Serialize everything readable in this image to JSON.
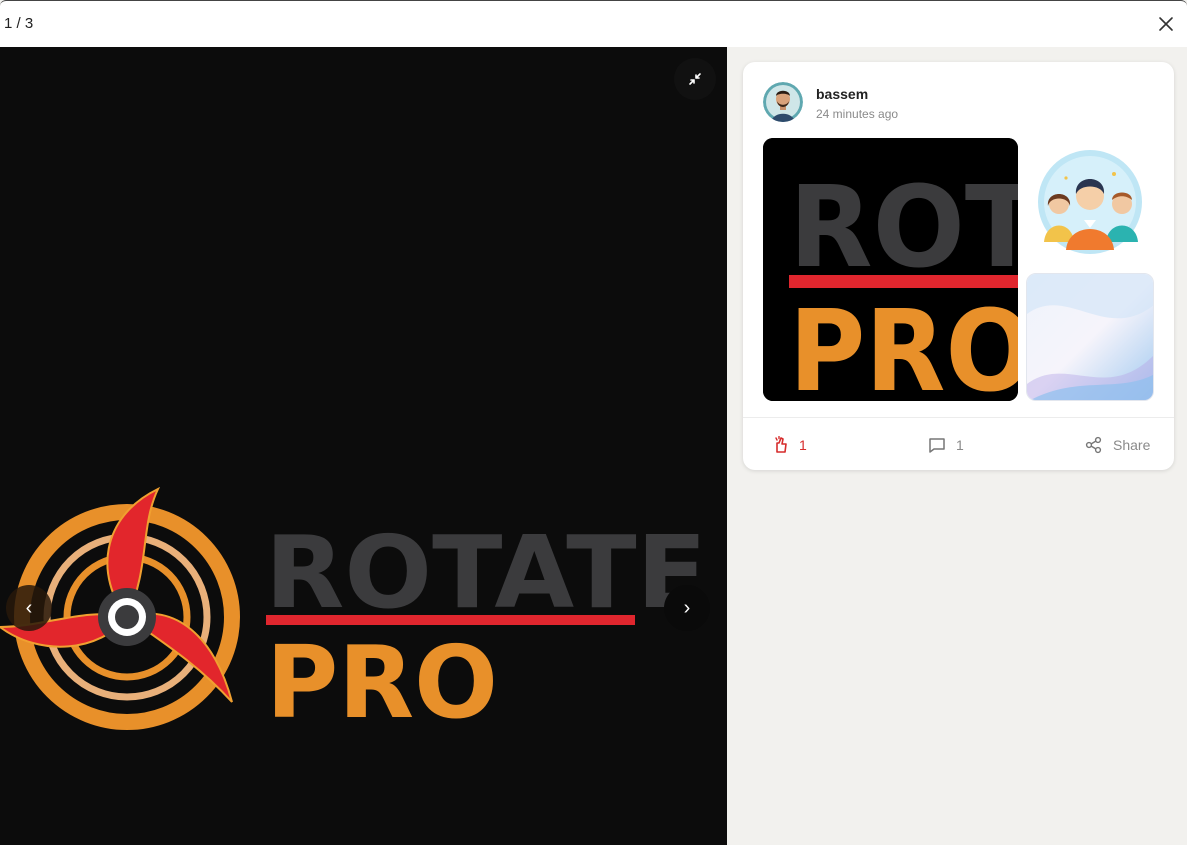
{
  "header": {
    "counter": "1 / 3",
    "close_icon": "close-icon"
  },
  "viewer": {
    "fullscreen_icon": "collapse-icon",
    "prev_label": "‹",
    "next_label": "›",
    "logo": {
      "word_top": "ROTATE",
      "word_bottom": "PRO",
      "colors": {
        "dark_text": "#3b3b3d",
        "bar": "#e0262e",
        "orange": "#e8902a",
        "red": "#e2262c"
      }
    }
  },
  "post": {
    "author": "bassem",
    "time": "24 minutes ago",
    "gallery": {
      "main_top": "ROT",
      "main_bottom": "PRO"
    },
    "actions": {
      "like_count": "1",
      "comment_count": "1",
      "share_label": "Share"
    }
  },
  "colors": {
    "like": "#d62c2c",
    "muted": "#8a8a8a",
    "background": "#f2f1ee"
  }
}
